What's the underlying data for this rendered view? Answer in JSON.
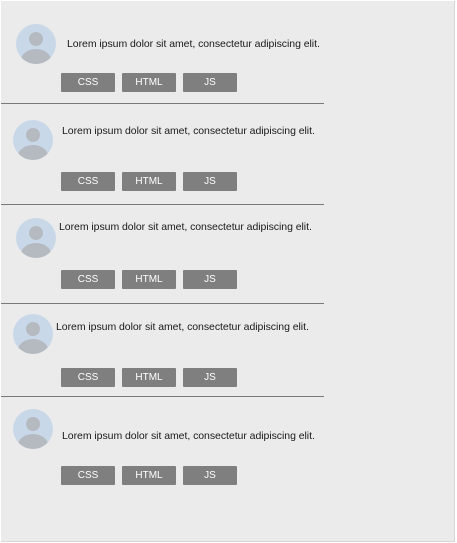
{
  "list": {
    "items": [
      {
        "text": "Lorem ipsum dolor sit amet, consectetur adipiscing elit.",
        "tags": [
          "CSS",
          "HTML",
          "JS"
        ]
      },
      {
        "text": "Lorem ipsum dolor sit amet, consectetur adipiscing elit.",
        "tags": [
          "CSS",
          "HTML",
          "JS"
        ]
      },
      {
        "text": "Lorem ipsum dolor sit amet, consectetur adipiscing elit.",
        "tags": [
          "CSS",
          "HTML",
          "JS"
        ]
      },
      {
        "text": "Lorem ipsum dolor sit amet, consectetur adipiscing elit.",
        "tags": [
          "CSS",
          "HTML",
          "JS"
        ]
      },
      {
        "text": "Lorem ipsum dolor sit amet, consectetur adipiscing elit.",
        "tags": [
          "CSS",
          "HTML",
          "JS"
        ]
      }
    ]
  },
  "icons": {
    "avatar": "user-avatar-icon"
  },
  "colors": {
    "background": "#ebebeb",
    "tag_background": "#7f7f7f",
    "tag_text": "#ffffff",
    "avatar_background": "#c9d8e8",
    "avatar_figure": "#b5bac1",
    "separator": "#7a7a7a"
  }
}
